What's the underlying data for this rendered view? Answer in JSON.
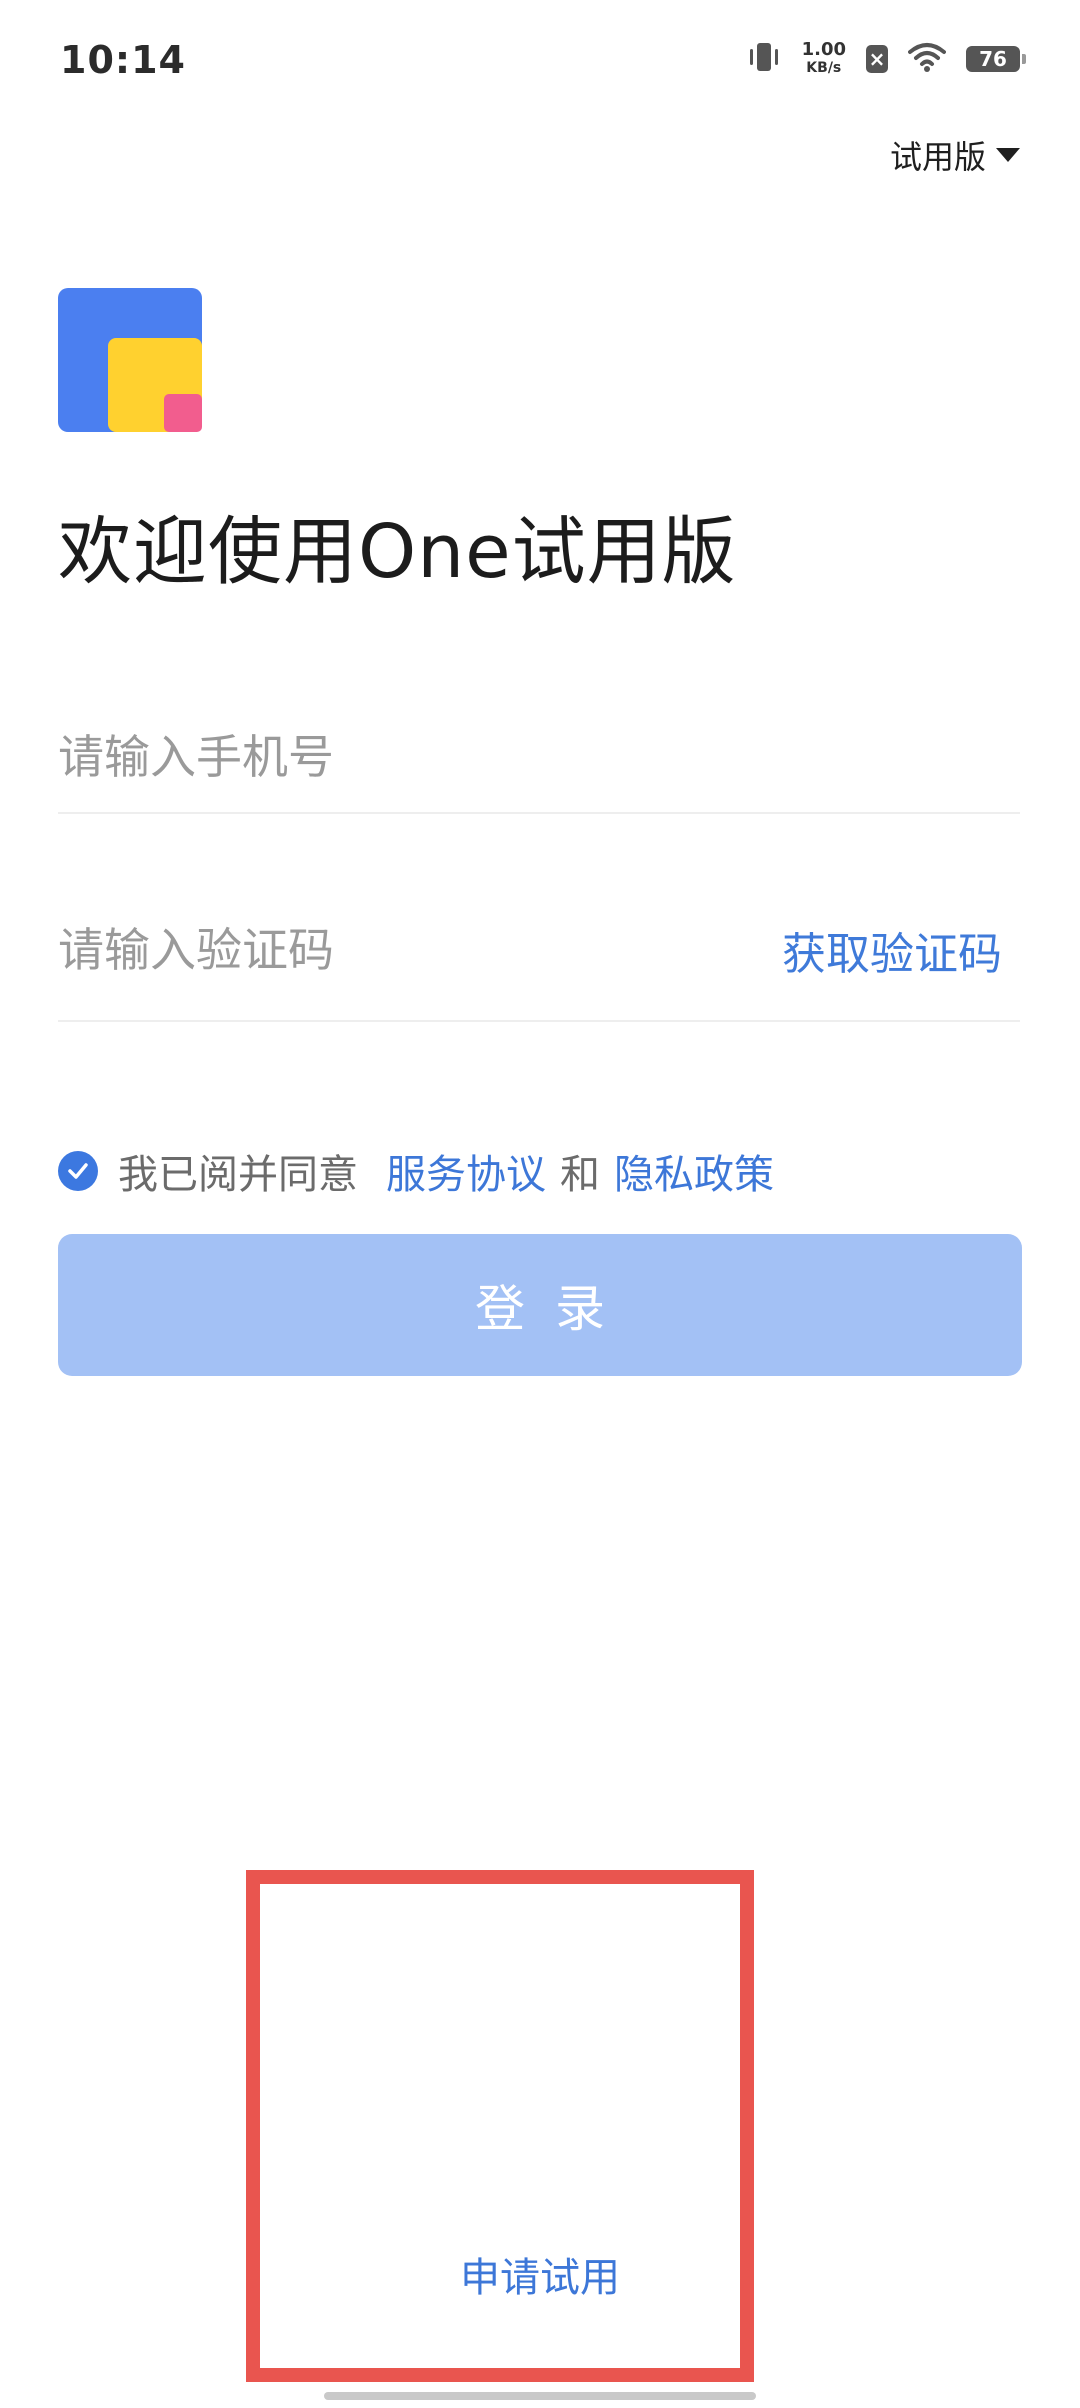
{
  "status_bar": {
    "time": "10:14",
    "net_speed_value": "1.00",
    "net_speed_unit": "KB/s",
    "battery": "76"
  },
  "version_selector": {
    "label": "试用版"
  },
  "welcome_title": "欢迎使用One试用版",
  "form": {
    "phone_placeholder": "请输入手机号",
    "code_placeholder": "请输入验证码",
    "get_code_label": "获取验证码"
  },
  "agreement": {
    "prefix": "我已阅并同意",
    "service_link": "服务协议",
    "and": "和",
    "privacy_link": "隐私政策",
    "checked": true
  },
  "login_button": {
    "label": "登录"
  },
  "apply_trial": {
    "label": "申请试用"
  },
  "colors": {
    "accent": "#3d77d8",
    "login_disabled": "#a3c1f5",
    "highlight": "#e9554f"
  }
}
